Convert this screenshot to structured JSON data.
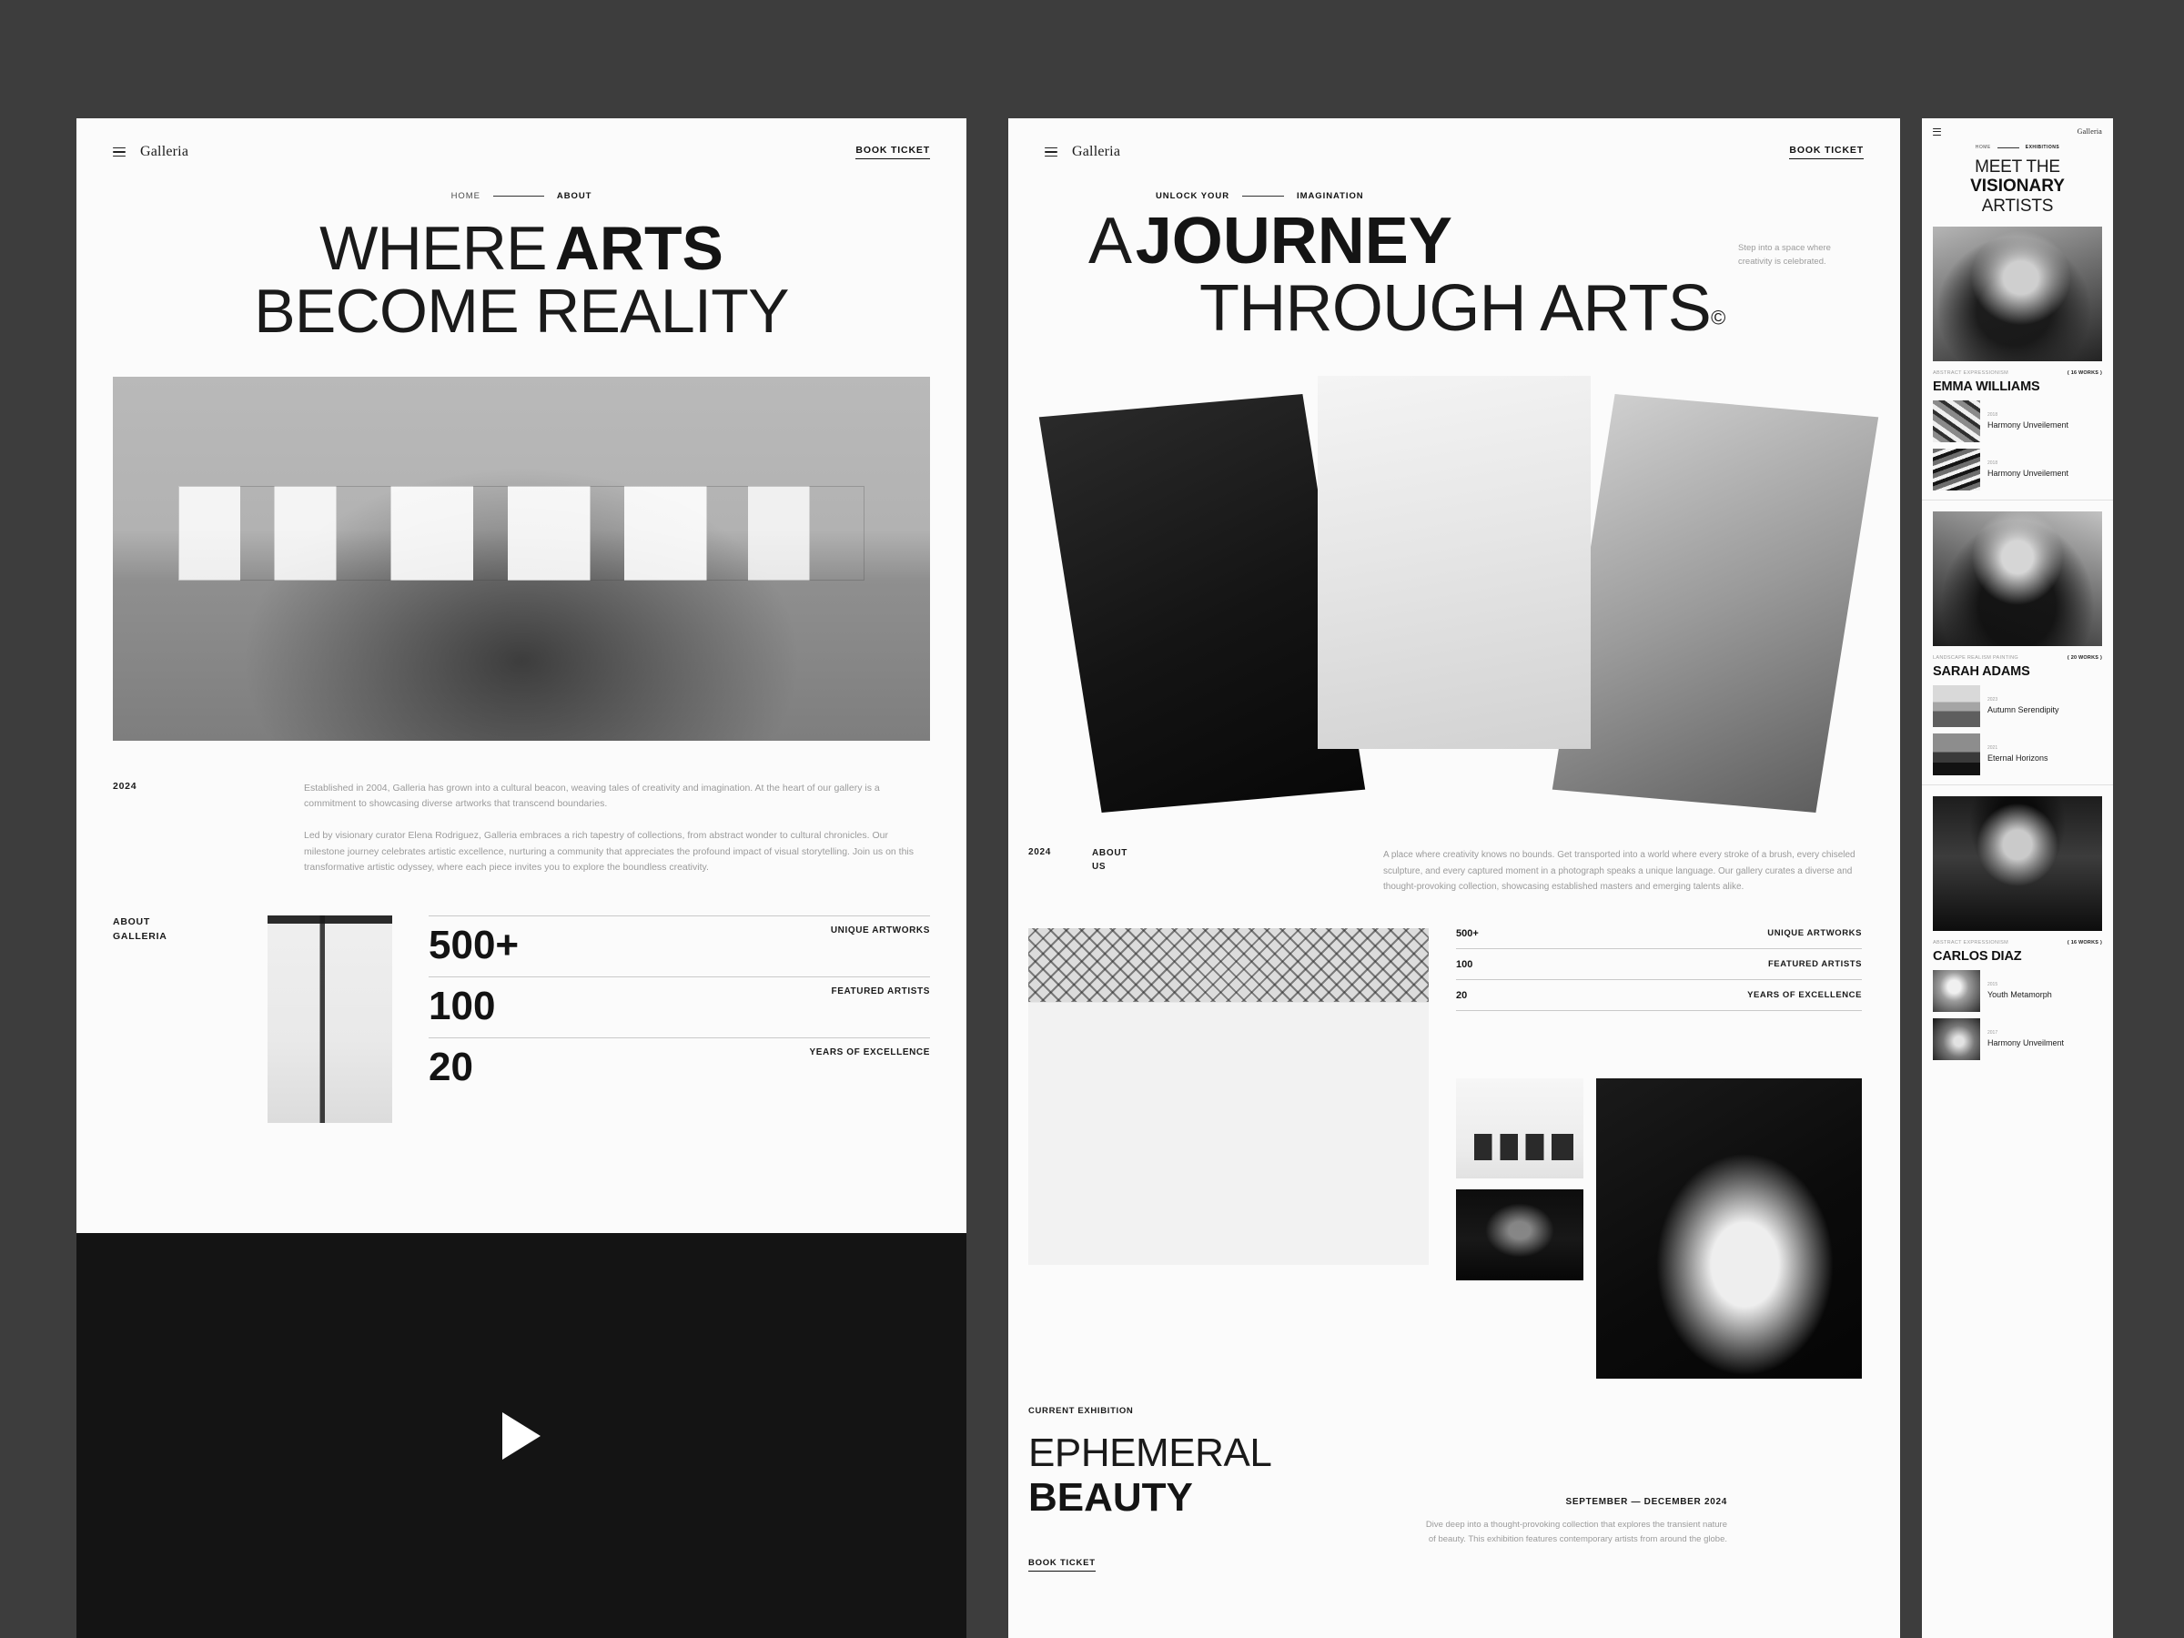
{
  "theme": {
    "page_bg": "#3d3d3d",
    "panel_bg": "#fbfbfb",
    "ink": "#111111",
    "muted": "#9b9b9b"
  },
  "panel1": {
    "nav": {
      "menu_icon": "hamburger-icon",
      "brand": "Galleria",
      "cta": "BOOK TICKET"
    },
    "breadcrumb": {
      "from": "HOME",
      "to": "ABOUT"
    },
    "hero": {
      "line1_light": "WHERE",
      "line1_bold": "ARTS",
      "line2": "BECOME REALITY"
    },
    "about": {
      "year": "2024",
      "para1": "Established in 2004, Galleria has grown into a cultural beacon, weaving tales of creativity and imagination. At the heart of our gallery is a commitment to showcasing diverse artworks that transcend boundaries.",
      "para2": "Led by visionary curator Elena Rodriguez, Galleria embraces a rich tapestry of collections, from abstract wonder to cultural chronicles. Our milestone journey celebrates artistic excellence, nurturing a community that appreciates the profound impact of visual storytelling. Join us on this transformative artistic odyssey, where each piece invites you to explore the boundless creativity."
    },
    "stats_label_line1": "ABOUT",
    "stats_label_line2": "GALLERIA",
    "stats": [
      {
        "value": "500+",
        "label": "UNIQUE ARTWORKS"
      },
      {
        "value": "100",
        "label": "FEATURED ARTISTS"
      },
      {
        "value": "20",
        "label": "YEARS OF EXCELLENCE"
      }
    ],
    "video": {
      "play_icon": "play-icon"
    }
  },
  "panel2": {
    "nav": {
      "menu_icon": "hamburger-icon",
      "brand": "Galleria",
      "cta": "BOOK TICKET"
    },
    "breadcrumb": {
      "from": "UNLOCK YOUR",
      "to": "IMAGINATION"
    },
    "hero": {
      "line1_light": "A",
      "line1_bold": "JOURNEY",
      "line2": "THROUGH ARTS",
      "superscript": "©",
      "side_note": "Step into a space where creativity is celebrated."
    },
    "about": {
      "year": "2024",
      "label_line1": "ABOUT",
      "label_line2": "US",
      "para": "A place where creativity knows no bounds. Get transported into a world where every stroke of a brush, every chiseled sculpture, and every captured moment in a photograph speaks a unique language. Our gallery curates a diverse and thought-provoking collection, showcasing established masters and emerging talents alike."
    },
    "stats": [
      {
        "value": "500+",
        "label": "UNIQUE ARTWORKS"
      },
      {
        "value": "100",
        "label": "FEATURED ARTISTS"
      },
      {
        "value": "20",
        "label": "YEARS OF EXCELLENCE"
      }
    ],
    "exhibition": {
      "eyebrow": "CURRENT EXHIBITION",
      "title_light": "EPHEMERAL",
      "title_bold": "BEAUTY",
      "dates": "SEPTEMBER — DECEMBER 2024",
      "description": "Dive deep into a thought-provoking collection that explores the transient nature of beauty. This exhibition features contemporary artists from around the globe.",
      "cta": "BOOK TICKET"
    }
  },
  "panel3": {
    "nav": {
      "menu_icon": "hamburger-icon",
      "brand": "Galleria"
    },
    "breadcrumb": {
      "from": "HOME",
      "to": "EXHIBITIONS"
    },
    "hero": {
      "line1": "MEET THE",
      "line2_bold": "VISIONARY",
      "line3": "ARTISTS"
    },
    "artists": [
      {
        "tag": "ABSTRACT EXPRESSIONISM",
        "works_count": "( 16 WORKS )",
        "name": "EMMA WILLIAMS",
        "portrait": "portrait-emma-williams",
        "works": [
          {
            "year": "2018",
            "title": "Harmony Unveilement"
          },
          {
            "year": "2018",
            "title": "Harmony Unveilement"
          }
        ]
      },
      {
        "tag": "LANDSCAPE REALISM PAINTING",
        "works_count": "( 20 WORKS )",
        "name": "SARAH ADAMS",
        "portrait": "portrait-sarah-adams",
        "works": [
          {
            "year": "2023",
            "title": "Autumn Serendipity"
          },
          {
            "year": "2021",
            "title": "Eternal Horizons"
          }
        ]
      },
      {
        "tag": "ABSTRACT EXPRESSIONISM",
        "works_count": "( 16 WORKS )",
        "name": "CARLOS DIAZ",
        "portrait": "portrait-carlos-diaz",
        "works": [
          {
            "year": "2015",
            "title": "Youth Metamorph"
          },
          {
            "year": "2017",
            "title": "Harmony Unveilment"
          }
        ]
      }
    ]
  }
}
